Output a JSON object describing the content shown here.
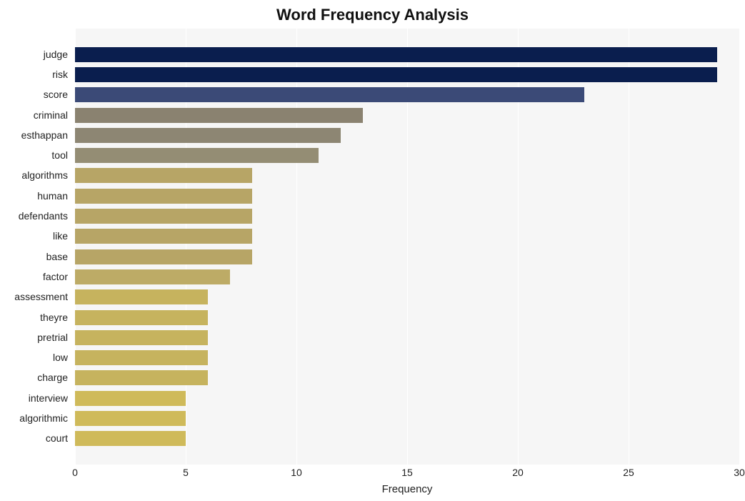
{
  "chart_data": {
    "type": "bar",
    "orientation": "horizontal",
    "title": "Word Frequency Analysis",
    "xlabel": "Frequency",
    "ylabel": "",
    "xlim": [
      0,
      30
    ],
    "xticks": [
      0,
      5,
      10,
      15,
      20,
      25,
      30
    ],
    "categories": [
      "judge",
      "risk",
      "score",
      "criminal",
      "esthappan",
      "tool",
      "algorithms",
      "human",
      "defendants",
      "like",
      "base",
      "factor",
      "assessment",
      "theyre",
      "pretrial",
      "low",
      "charge",
      "interview",
      "algorithmic",
      "court"
    ],
    "values": [
      29,
      29,
      23,
      13,
      12,
      11,
      8,
      8,
      8,
      8,
      8,
      7,
      6,
      6,
      6,
      6,
      6,
      5,
      5,
      5
    ],
    "colors": [
      "#0a1e4e",
      "#0a1e4e",
      "#3b4a77",
      "#8a8270",
      "#8d8673",
      "#948d74",
      "#b7a566",
      "#b7a566",
      "#b7a566",
      "#b7a566",
      "#b7a566",
      "#bdab66",
      "#c6b35e",
      "#c6b35e",
      "#c6b35e",
      "#c6b35e",
      "#c6b35e",
      "#cfba5a",
      "#cfba5a",
      "#cfba5a"
    ]
  }
}
